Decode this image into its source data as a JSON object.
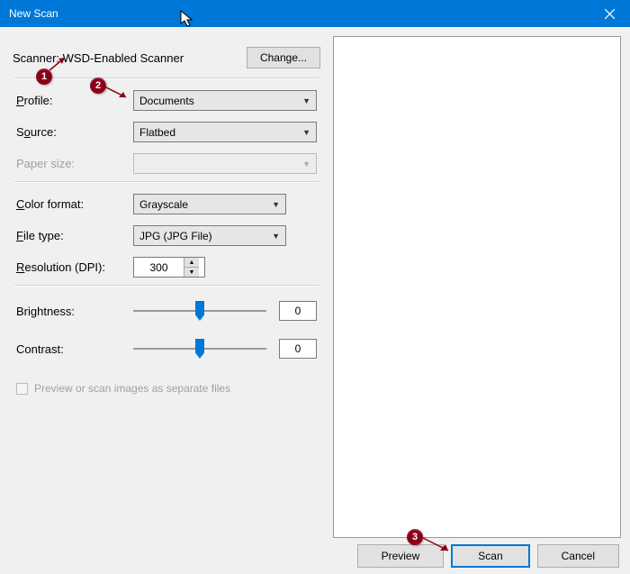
{
  "title": "New Scan",
  "scanner": {
    "label_prefix": "Scanner: ",
    "name": "WSD-Enabled Scanner"
  },
  "change_button": "Change...",
  "labels": {
    "profile": "Profile:",
    "source": "Source:",
    "paper_size": "Paper size:",
    "color_format": "Color format:",
    "file_type": "File type:",
    "resolution": "Resolution (DPI):",
    "brightness": "Brightness:",
    "contrast": "Contrast:"
  },
  "values": {
    "profile": "Documents",
    "source": "Flatbed",
    "paper_size": "",
    "color_format": "Grayscale",
    "file_type": "JPG (JPG File)",
    "resolution": "300",
    "brightness": "0",
    "contrast": "0"
  },
  "checkbox_label": "Preview or scan images as separate files",
  "footer": {
    "preview": "Preview",
    "scan": "Scan",
    "cancel": "Cancel"
  },
  "annotations": {
    "b1": "1",
    "b2": "2",
    "b3": "3"
  }
}
